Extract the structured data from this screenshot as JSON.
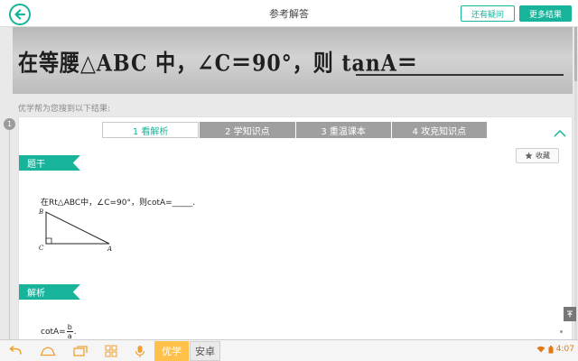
{
  "header": {
    "title": "参考解答",
    "ask_label": "还有疑问",
    "more_label": "更多结果"
  },
  "photo": {
    "text": "在等腰△ABC 中，∠C＝90°，则 tanA＝"
  },
  "result_hint": "优学帮为您搜到以下结果:",
  "result_index": "1",
  "steps": [
    {
      "label": "1 看解析"
    },
    {
      "label": "2 学知识点"
    },
    {
      "label": "3 重温课本"
    },
    {
      "label": "4 攻克知识点"
    }
  ],
  "question": {
    "tag": "题干",
    "favorite_label": "收藏",
    "text": "在Rt△ABC中，∠C=90°，则cotA=_____.",
    "vertices": {
      "b": "B",
      "c": "C",
      "a": "A"
    }
  },
  "analysis": {
    "tag": "解析",
    "prefix": "cotA=",
    "numerator": "b",
    "denominator": "a",
    "suffix": "."
  },
  "navbar": {
    "app_active": "优学",
    "app_other": "安卓",
    "time": "4:07"
  },
  "colors": {
    "accent": "#17b39a",
    "app_active": "#ffc14a",
    "status": "#e07a14"
  },
  "icons": [
    "back-arrow-icon",
    "chevron-up-icon",
    "star-icon",
    "back-icon",
    "home-icon",
    "recent-apps-icon",
    "grid-icon",
    "microphone-icon",
    "wifi-icon",
    "battery-icon"
  ]
}
